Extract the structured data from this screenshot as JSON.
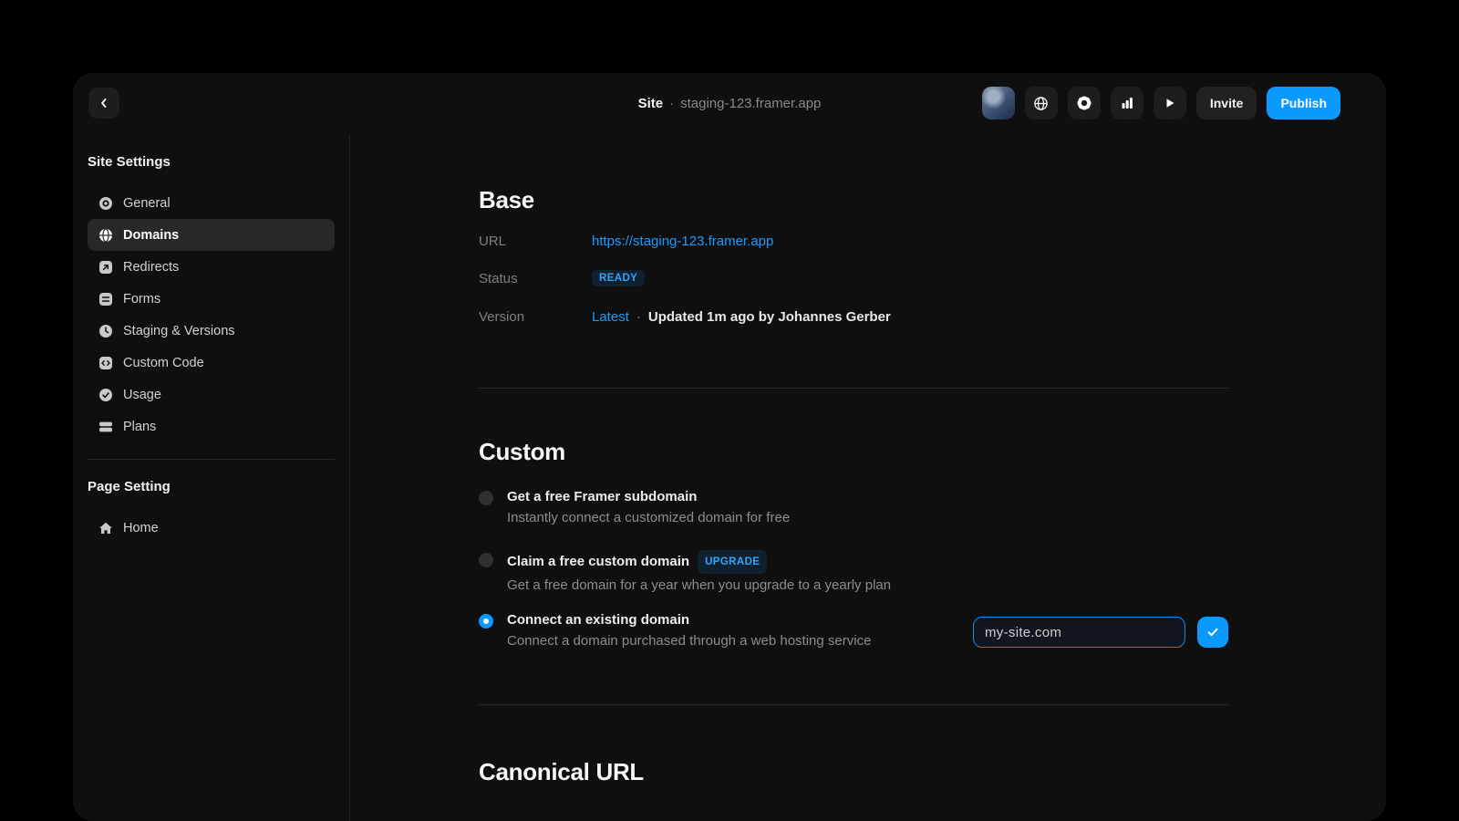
{
  "topbar": {
    "title_primary": "Site",
    "title_separator": "·",
    "title_secondary": "staging-123.framer.app",
    "invite_label": "Invite",
    "publish_label": "Publish"
  },
  "sidebar": {
    "section1_title": "Site Settings",
    "items": [
      {
        "label": "General",
        "icon": "target-icon",
        "selected": false
      },
      {
        "label": "Domains",
        "icon": "globe-icon",
        "selected": true
      },
      {
        "label": "Redirects",
        "icon": "redirect-arrow-icon",
        "selected": false
      },
      {
        "label": "Forms",
        "icon": "forms-icon",
        "selected": false
      },
      {
        "label": "Staging & Versions",
        "icon": "clock-icon",
        "selected": false
      },
      {
        "label": "Custom Code",
        "icon": "code-icon",
        "selected": false
      },
      {
        "label": "Usage",
        "icon": "usage-icon",
        "selected": false
      },
      {
        "label": "Plans",
        "icon": "plans-icon",
        "selected": false
      }
    ],
    "section2_title": "Page Setting",
    "page_items": [
      {
        "label": "Home",
        "icon": "home-icon",
        "selected": false
      }
    ]
  },
  "base": {
    "heading": "Base",
    "url_label": "URL",
    "url_value": "https://staging-123.framer.app",
    "status_label": "Status",
    "status_value": "READY",
    "version_label": "Version",
    "version_value": "Latest",
    "version_separator": "·",
    "version_note": "Updated 1m ago by Johannes Gerber"
  },
  "custom": {
    "heading": "Custom",
    "options": [
      {
        "title": "Get a free Framer subdomain",
        "subtitle": "Instantly connect a customized domain for free",
        "selected": false
      },
      {
        "title": "Claim a free custom domain",
        "badge": "UPGRADE",
        "subtitle": "Get a free domain for a year when you upgrade to a yearly plan",
        "selected": false
      },
      {
        "title": "Connect an existing domain",
        "subtitle": "Connect a domain purchased through a web hosting service",
        "selected": true
      }
    ],
    "domain_input_value": "my-site.com"
  },
  "canonical": {
    "heading": "Canonical URL"
  },
  "colors": {
    "accent": "#0a99ff",
    "status_badge": "#2ea6ff",
    "link": "#1a9bff"
  }
}
